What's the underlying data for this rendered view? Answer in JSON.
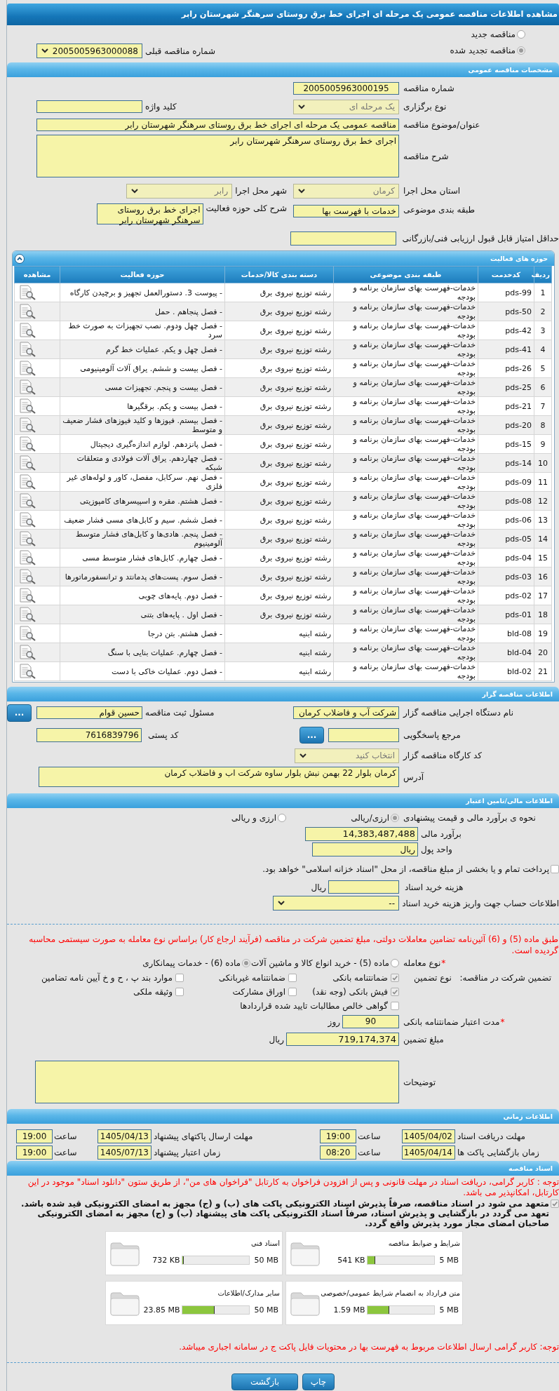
{
  "page_title": "مشاهده اطلاعات مناقصه عمومی یک مرحله ای اجرای خط برق روستای سرهنگر شهرستان رابر",
  "tender_status": [
    {
      "label": "مناقصه جدید",
      "selected": false
    },
    {
      "label": "مناقصه تجدید شده",
      "selected": true
    }
  ],
  "previous_tender": {
    "label": "شماره مناقصه قبلی",
    "value": "2005005963000088",
    "disabled": false
  },
  "general": {
    "title": "مشخصات مناقصه عمومی",
    "tender_number": {
      "label": "شماره مناقصه",
      "value": "2005005963000195"
    },
    "holding_type": {
      "label": "نوع برگزاری",
      "value": "یک مرحله ای",
      "disabled": true
    },
    "keyword": {
      "label": "کلید واژه"
    },
    "subject": {
      "label": "عنوان/موضوع مناقصه",
      "value": "مناقصه عمومی یک مرحله ای اجرای خط برق روستای سرهنگر شهرستان رابر"
    },
    "description": {
      "label": "شرح مناقصه",
      "value": "اجرای خط برق روستای سرهنگر شهرستان رابر"
    },
    "province": {
      "label": "استان محل اجرا",
      "value": "کرمان",
      "disabled": true
    },
    "city": {
      "label": "شهر محل اجرا",
      "value": "رابر",
      "disabled": true
    },
    "classification": {
      "label": "طبقه بندی موضوعی",
      "value": "خدمات با فهرست بها"
    },
    "activity_summary": {
      "label": "شرح کلی حوزه فعالیت",
      "value": "اجرای خط برق روستای سرهنگر شهرستان رابر"
    },
    "min_score": {
      "label": "حداقل امتیاز قابل قبول ارزیابی فنی/بازرگانی"
    }
  },
  "activities": {
    "title": "حوزه های فعالیت",
    "expanded": true,
    "columns": [
      "ردیف",
      "کدخدمت",
      "طبقه بندی موضوعی",
      "دسته بندی کالا/خدمات",
      "حوزه فعالیت",
      "مشاهده"
    ],
    "rows": [
      {
        "number": "1",
        "code": "pds-99",
        "classification": "خدمات-فهرست بهای سازمان برنامه و بودجه",
        "category": "رشته توزیع نیروی برق",
        "activity": "- پیوست 3. دستورالعمل تجهیز و برچیدن کارگاه"
      },
      {
        "number": "2",
        "code": "pds-50",
        "classification": "خدمات-فهرست بهای سازمان برنامه و بودجه",
        "category": "رشته توزیع نیروی برق",
        "activity": "- فصل پنجاهم . حمل"
      },
      {
        "number": "3",
        "code": "pds-42",
        "classification": "خدمات-فهرست بهای سازمان برنامه و بودجه",
        "category": "رشته توزیع نیروی برق",
        "activity": "- فصل چهل ودوم. نصب تجهیزات به صورت خط سرد"
      },
      {
        "number": "4",
        "code": "pds-41",
        "classification": "خدمات-فهرست بهای سازمان برنامه و بودجه",
        "category": "رشته توزیع نیروی برق",
        "activity": "- فصل چهل و یکم. عملیات خط گرم"
      },
      {
        "number": "5",
        "code": "pds-26",
        "classification": "خدمات-فهرست بهای سازمان برنامه و بودجه",
        "category": "رشته توزیع نیروی برق",
        "activity": "- فصل بیست و ششم. یراق آلات آلومینیومی"
      },
      {
        "number": "6",
        "code": "pds-25",
        "classification": "خدمات-فهرست بهای سازمان برنامه و بودجه",
        "category": "رشته توزیع نیروی برق",
        "activity": "- فصل بیست و پنجم. تجهیزات مسی"
      },
      {
        "number": "7",
        "code": "pds-21",
        "classification": "خدمات-فهرست بهای سازمان برنامه و بودجه",
        "category": "رشته توزیع نیروی برق",
        "activity": "- فصل بیست و یکم. برقگیرها"
      },
      {
        "number": "8",
        "code": "pds-20",
        "classification": "خدمات-فهرست بهای سازمان برنامه و بودجه",
        "category": "رشته توزیع نیروی برق",
        "activity": "- فصل بیستم. فیوزها و کلید فیوزهای فشار ضعیف و متوسط"
      },
      {
        "number": "9",
        "code": "pds-15",
        "classification": "خدمات-فهرست بهای سازمان برنامه و بودجه",
        "category": "رشته توزیع نیروی برق",
        "activity": "- فصل پانزدهم. لوازم اندازه‌گیری دیجیتال"
      },
      {
        "number": "10",
        "code": "pds-14",
        "classification": "خدمات-فهرست بهای سازمان برنامه و بودجه",
        "category": "رشته توزیع نیروی برق",
        "activity": "- فصل چهاردهم. یراق آلات فولادی و متعلقات شبکه"
      },
      {
        "number": "11",
        "code": "pds-09",
        "classification": "خدمات-فهرست بهای سازمان برنامه و بودجه",
        "category": "رشته توزیع نیروی برق",
        "activity": "- فصل نهم. سرکابل، مفصل، کاور و لوله‌های غیر فلزی"
      },
      {
        "number": "12",
        "code": "pds-08",
        "classification": "خدمات-فهرست بهای سازمان برنامه و بودجه",
        "category": "رشته توزیع نیروی برق",
        "activity": "- فصل هشتم. مقره و اسپیسرهای کامپوزیتی"
      },
      {
        "number": "13",
        "code": "pds-06",
        "classification": "خدمات-فهرست بهای سازمان برنامه و بودجه",
        "category": "رشته توزیع نیروی برق",
        "activity": "- فصل ششم. سیم و کابل‌های مسی فشار ضعیف"
      },
      {
        "number": "14",
        "code": "pds-05",
        "classification": "خدمات-فهرست بهای سازمان برنامه و بودجه",
        "category": "رشته توزیع نیروی برق",
        "activity": "- فصل پنجم. هادی‌ها و کابل‌های فشار متوسط آلومینیوم"
      },
      {
        "number": "15",
        "code": "pds-04",
        "classification": "خدمات-فهرست بهای سازمان برنامه و بودجه",
        "category": "رشته توزیع نیروی برق",
        "activity": "- فصل چهارم. کابل‌های فشار متوسط مسی"
      },
      {
        "number": "16",
        "code": "pds-03",
        "classification": "خدمات-فهرست بهای سازمان برنامه و بودجه",
        "category": "رشته توزیع نیروی برق",
        "activity": "- فصل سوم. پست‌های پدمانتد و ترانسفورماتورها"
      },
      {
        "number": "17",
        "code": "pds-02",
        "classification": "خدمات-فهرست بهای سازمان برنامه و بودجه",
        "category": "رشته توزیع نیروی برق",
        "activity": "- فصل دوم. پایه‌های چوبی"
      },
      {
        "number": "18",
        "code": "pds-01",
        "classification": "خدمات-فهرست بهای سازمان برنامه و بودجه",
        "category": "رشته توزیع نیروی برق",
        "activity": "- فصل اول . پایه‌های بتنی"
      },
      {
        "number": "19",
        "code": "bld-08",
        "classification": "خدمات-فهرست بهای سازمان برنامه و بودجه",
        "category": "رشته ابنیه",
        "activity": "- فصل هشتم. بتن درجا"
      },
      {
        "number": "20",
        "code": "bld-04",
        "classification": "خدمات-فهرست بهای سازمان برنامه و بودجه",
        "category": "رشته ابنیه",
        "activity": "- فصل چهارم. عملیات بنایی با سنگ"
      },
      {
        "number": "21",
        "code": "bld-02",
        "classification": "خدمات-فهرست بهای سازمان برنامه و بودجه",
        "category": "رشته ابنیه",
        "activity": "- فصل دوم. عملیات خاکی با دست"
      }
    ]
  },
  "organizer": {
    "title": "اطلاعات مناقصه گزار",
    "agency": {
      "label": "نام دستگاه اجرایی مناقصه گزار",
      "value": "شرکت آب و فاضلاب کرمان"
    },
    "registrar": {
      "label": "مسئول ثبت مناقصه",
      "value": "حسین قوام",
      "button": "..."
    },
    "reference": {
      "label": "مرجع پاسخگویی",
      "button": "..."
    },
    "postal_code": {
      "label": "کد پستی",
      "value": "7616839796"
    },
    "workshop_code": {
      "label": "کد کارگاه مناقصه گزار",
      "value": "انتخاب کنید",
      "disabled": true
    },
    "address": {
      "label": "آدرس",
      "value": "کرمان بلوار 22 بهمن نبش بلوار ساوه شرکت اب و فاضلاب کرمان"
    }
  },
  "finance": {
    "title": "اطلاعات مالی/تامین اعتبار",
    "estimate_method": {
      "label": "نحوه ی برآورد مالی و قیمت پیشنهادی",
      "options": [
        {
          "label": "ارزی/ریالی",
          "selected": true
        },
        {
          "label": "ارزی و ریالی",
          "selected": false
        }
      ]
    },
    "estimate": {
      "label": "برآورد مالی",
      "value": "14,383,487,488"
    },
    "currency": {
      "label": "واحد پول",
      "value": "ریال"
    },
    "treasury": {
      "label": "پرداخت تمام و یا بخشی از مبلغ مناقصه، از محل \"اسناد خزانه اسلامی\" خواهد بود.",
      "checked": false
    },
    "document_fee": {
      "label": "هزینه خرید اسناد",
      "unit": "ریال"
    },
    "fee_account": {
      "label": "اطلاعات حساب جهت واریز هزینه خرید اسناد",
      "value": "--",
      "disabled": false
    },
    "notice": "طبق ماده (5) و (6) آئین‌نامه تضامین معاملات دولتی، مبلغ تضمین شرکت در مناقصه (فرآیند ارجاع کار) براساس نوع معامله به صورت سیستمی محاسبه گردیده است.",
    "deal_type": {
      "mark": "*",
      "label": "نوع معامله",
      "options": [
        {
          "label": "ماده (5) - خرید انواع کالا و ماشین آلات",
          "selected": false
        },
        {
          "label": "ماده (6) - خدمات پیمانکاری",
          "selected": true
        }
      ]
    },
    "guarantee": {
      "label": "تضمین شرکت در مناقصه:",
      "type_label": "نوع تضمین",
      "options": [
        {
          "label": "ضمانتنامه بانکی",
          "checked": true
        },
        {
          "label": "ضمانتنامه غیربانکی",
          "checked": false
        },
        {
          "label": "موارد بند پ ، ح و خ آیین نامه تضامین",
          "checked": false
        },
        {
          "label": "فیش بانکی (وجه نقد)",
          "checked": true
        },
        {
          "label": "اوراق مشارکت",
          "checked": false
        },
        {
          "label": "وثیقه ملکی",
          "checked": false
        },
        {
          "label": "گواهی خالص مطالبات تایید شده قراردادها",
          "checked": false
        }
      ]
    },
    "guarantee_validity": {
      "mark": "*",
      "label": "مدت اعتبار ضمانتنامه بانکی",
      "value": "90",
      "unit": "روز"
    },
    "guarantee_amount": {
      "label": "مبلغ تضمین",
      "value": "719,174,374",
      "unit": "ریال"
    },
    "notes": {
      "label": "توضیحات"
    }
  },
  "timing": {
    "title": "اطلاعات زمانی",
    "items": [
      {
        "label": "مهلت دریافت اسناد",
        "date": "1405/04/02",
        "time_label": "ساعت",
        "time": "19:00"
      },
      {
        "label": "مهلت ارسال پاکتهای پیشنهاد",
        "date": "1405/04/13",
        "time_label": "ساعت",
        "time": "19:00"
      },
      {
        "label": "زمان بازگشایی پاکت ها",
        "date": "1405/04/14",
        "time_label": "ساعت",
        "time": "08:20"
      },
      {
        "label": "زمان اعتبار پیشنهاد",
        "date": "1405/07/13",
        "time_label": "ساعت",
        "time": "19:00"
      }
    ]
  },
  "documents": {
    "title": "اسناد مناقصه",
    "notice": "توجه : کاربر گرامی، دریافت اسناد در مهلت قانونی و پس از افزودن فراخوان به کارتابل \"فراخوان های من\"، از طریق ستون \"دانلود اسناد\" موجود در این کارتابل، امکانپذیر می باشد.",
    "commitment": {
      "text": "متعهد می شود در اسناد مناقصه، صرفاً پذیرش اسناد الکترونیکی پاکت های (ب) و (ج) مجهز به امضای الکترونیکی قید شده باشد. تعهد می گردد در بازگشایی و پذیرش اسناد، صرفاً اسناد الکترونیکی پاکت های پیشنهاد (ب) و (ج) مجهز به امضای الکترونیکی صاحبان امضای مجاز مورد پذیرش واقع گردد.",
      "checked": true
    },
    "files": [
      {
        "title": "شرایط و ضوابط مناقصه",
        "limit": "5 MB",
        "size": "541 KB",
        "level": 0.11
      },
      {
        "title": "اسناد فنی",
        "limit": "50 MB",
        "size": "732 KB",
        "level": 0.015
      },
      {
        "title": "متن قرارداد به انضمام شرایط عمومی/خصوصی",
        "limit": "5 MB",
        "size": "1.59 MB",
        "level": 0.32
      },
      {
        "title": "سایر مدارک/اطلاعات",
        "limit": "50 MB",
        "size": "23.85 MB",
        "level": 0.48
      }
    ],
    "footer_note": "توجه: کاربر گرامی ارسال اطلاعات مربوط به فهرست بها در محتویات فایل پاکت ج در سامانه اجباری میباشد."
  },
  "buttons": [
    "چاپ",
    "بازگشت"
  ]
}
